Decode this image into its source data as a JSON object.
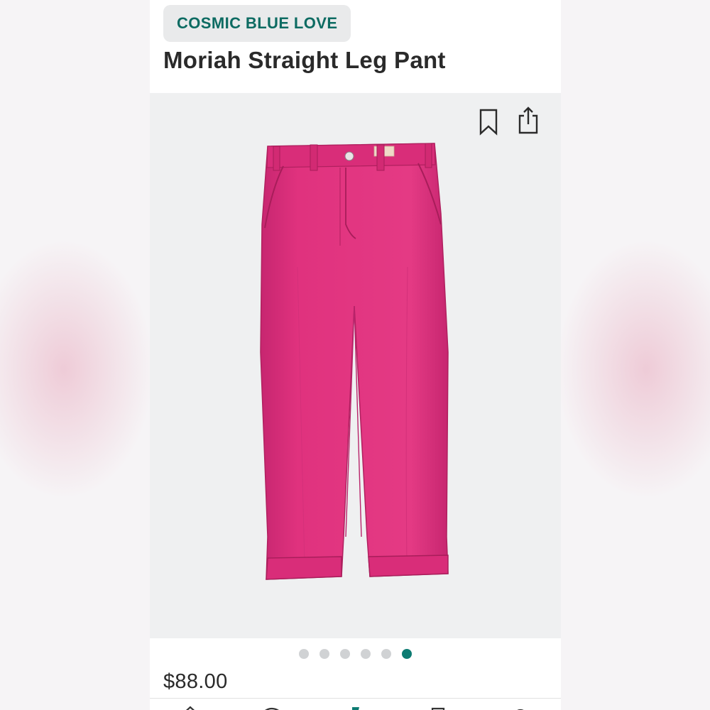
{
  "product": {
    "brand": "COSMIC BLUE LOVE",
    "title": "Moriah Straight Leg Pant",
    "price": "$88.00",
    "garment_color": "#e1337f"
  },
  "image_toolbar": {
    "icons": [
      "bookmark-icon",
      "share-icon"
    ]
  },
  "carousel": {
    "total": 6,
    "active_index": 6,
    "active_color": "#0d7b72",
    "inactive_color": "#d0d2d4"
  },
  "bottom_nav": {
    "icons": [
      "home-icon",
      "shield-icon",
      "flag-icon",
      "bag-icon",
      "account-icon"
    ]
  },
  "colors": {
    "accent": "#0d6b62",
    "chip_background": "#e9eaeb",
    "image_background": "#eff0f1"
  }
}
